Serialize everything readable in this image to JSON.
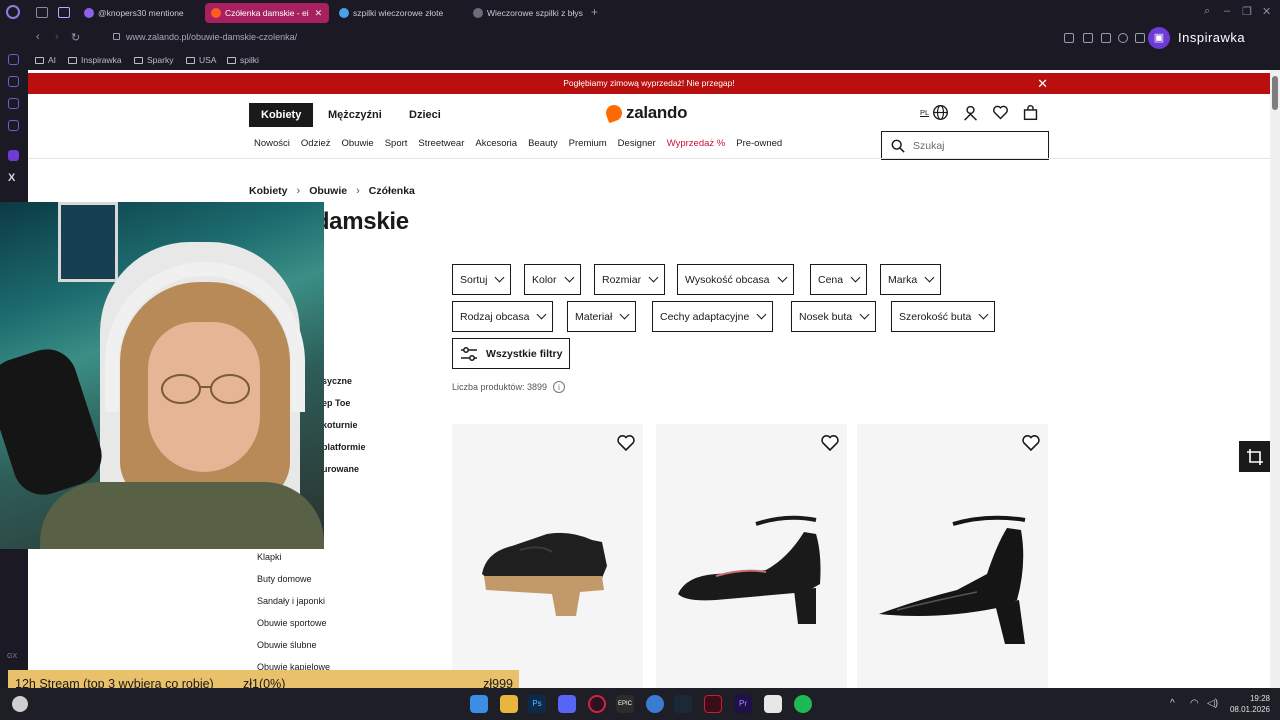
{
  "browser": {
    "tabs": [
      {
        "label": "@knopers30 mentione",
        "active": false
      },
      {
        "label": "Czółenka damskie - ei",
        "active": true
      },
      {
        "label": "szpilki wieczorowe złote",
        "active": false
      },
      {
        "label": "Wieczorowe szpilki z błys",
        "active": false
      }
    ],
    "url": "www.zalando.pl/obuwie-damskie-czolenka/",
    "channel": "Inspirawka",
    "bookmarks": [
      "AI",
      "Inspirawka",
      "Sparky",
      "USA",
      "spilki"
    ]
  },
  "promo": {
    "text": "Pogłębiamy zimową wyprzedaż! Nie przegap!"
  },
  "header": {
    "gender_tabs": [
      "Kobiety",
      "Mężczyźni",
      "Dzieci"
    ],
    "logo": "zalando",
    "lang": "PL",
    "categories": [
      "Nowości",
      "Odzież",
      "Obuwie",
      "Sport",
      "Streetwear",
      "Akcesoria",
      "Beauty",
      "Premium",
      "Designer",
      "Wyprzedaż %",
      "Pre-owned"
    ],
    "search_placeholder": "Szukaj"
  },
  "breadcrumb": [
    "Kobiety",
    "Obuwie",
    "Czółenka"
  ],
  "page_title": "Czółenka damskie",
  "page_title_visible": "nka damskie",
  "filters_row1": [
    "Sortuj",
    "Kolor",
    "Rozmiar",
    "Wysokość obcasa",
    "Cena",
    "Marka"
  ],
  "filters_row2": [
    "Rodzaj obcasa",
    "Materiał",
    "Cechy adaptacyjne",
    "Nosek buta",
    "Szerokość buta"
  ],
  "all_filters_label": "Wszystkie filtry",
  "product_count": "Liczba produktów: 3899",
  "subcategories_partial": [
    "syczne",
    "ep Toe",
    "koturnie",
    "platformie",
    "urowane"
  ],
  "subcategories": [
    "Klapki",
    "Buty domowe",
    "Sandały i japonki",
    "Obuwie sportowe",
    "Obuwie ślubne",
    "Obuwie kąpielowe"
  ],
  "stream_bar": {
    "title": "12h Stream (top 3 wybiera co robie)",
    "progress": "zł1(0%)",
    "goal": "zł999"
  },
  "taskbar": {
    "time": "19:28",
    "date": "08.01.2026"
  },
  "colors": {
    "promo_bg": "#b90f0f",
    "brand_orange": "#ff6900",
    "sale_red": "#d0103a",
    "stream_bar": "#e9c16a"
  }
}
